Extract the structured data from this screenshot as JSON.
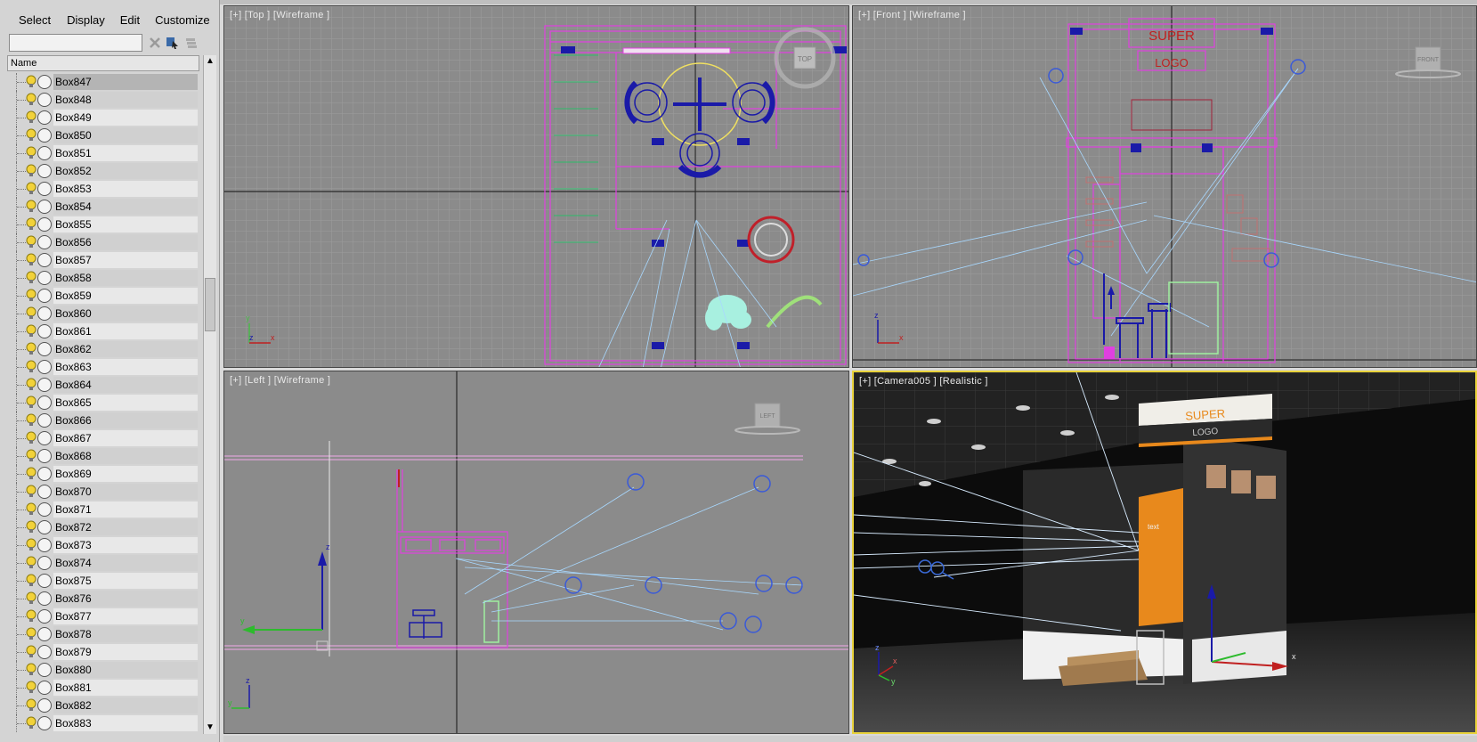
{
  "menu": [
    "Select",
    "Display",
    "Edit",
    "Customize"
  ],
  "search": {
    "value": "",
    "placeholder": ""
  },
  "list_header": "Name",
  "objects": [
    "Box847",
    "Box848",
    "Box849",
    "Box850",
    "Box851",
    "Box852",
    "Box853",
    "Box854",
    "Box855",
    "Box856",
    "Box857",
    "Box858",
    "Box859",
    "Box860",
    "Box861",
    "Box862",
    "Box863",
    "Box864",
    "Box865",
    "Box866",
    "Box867",
    "Box868",
    "Box869",
    "Box870",
    "Box871",
    "Box872",
    "Box873",
    "Box874",
    "Box875",
    "Box876",
    "Box877",
    "Box878",
    "Box879",
    "Box880",
    "Box881",
    "Box882",
    "Box883"
  ],
  "selected_object": "Box847",
  "viewports": {
    "top": {
      "label": "[+] [Top ] [Wireframe ]",
      "cube": "TOP"
    },
    "front": {
      "label": "[+] [Front ] [Wireframe ]",
      "cube": "FRONT"
    },
    "left": {
      "label": "[+] [Left ] [Wireframe ]",
      "cube": "LEFT"
    },
    "camera": {
      "label": "[+] [Camera005 ] [Realistic ]"
    }
  },
  "scene_text": {
    "super": "SUPER",
    "logo": "LOGO",
    "text": "text"
  },
  "axes": {
    "x": "x",
    "y": "y",
    "z": "z"
  },
  "colors": {
    "viewport_bg": "#888888",
    "grid": "#9a9a9a",
    "magenta": "#e040e0",
    "blue": "#1a1aa8",
    "light_blue": "#9fd0ff",
    "orange": "#e8891c",
    "active_border": "#e8d23a"
  }
}
